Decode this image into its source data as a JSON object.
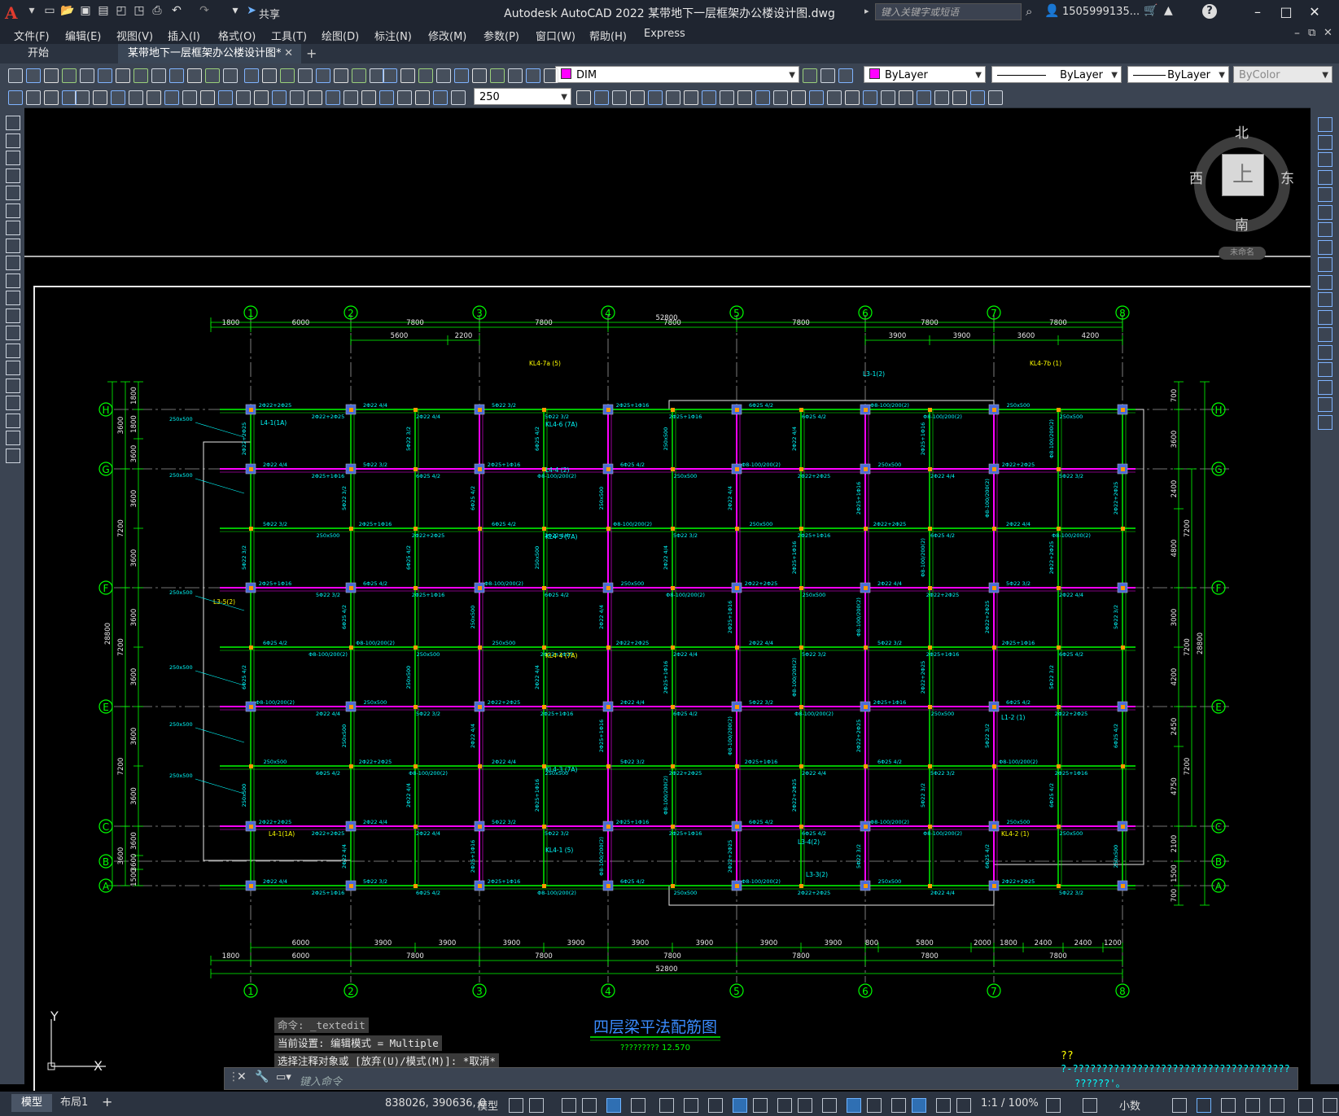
{
  "app": {
    "title": "Autodesk AutoCAD 2022    某带地下一层框架办公楼设计图.dwg",
    "share_label": "共享",
    "search_placeholder": "键入关键字或短语",
    "user": "1505999135...",
    "accent": "#e23b2e"
  },
  "menu": [
    "文件(F)",
    "编辑(E)",
    "视图(V)",
    "插入(I)",
    "格式(O)",
    "工具(T)",
    "绘图(D)",
    "标注(N)",
    "修改(M)",
    "参数(P)",
    "窗口(W)",
    "帮助(H)",
    "Express"
  ],
  "tabs": [
    {
      "label": "开始",
      "active": false
    },
    {
      "label": "某带地下一层框架办公楼设计图*",
      "active": true
    }
  ],
  "toolbar": {
    "layer": "DIM",
    "color": "ByLayer",
    "linetype": "ByLayer",
    "lineweight": "ByLayer",
    "plotstyle": "ByColor",
    "dimscale": "250"
  },
  "viewcube": {
    "north": "北",
    "south": "南",
    "east": "东",
    "west": "西",
    "face": "上",
    "wcs": "未命名"
  },
  "drawing": {
    "title": "四层梁平法配筋图",
    "subtitle": "?????????  12.570",
    "col_axes": [
      "1",
      "2",
      "3",
      "4",
      "5",
      "6",
      "7",
      "8"
    ],
    "row_axes": [
      "H",
      "G",
      "F",
      "E",
      "C",
      "B",
      "A"
    ],
    "top_dims_1": [
      "1800",
      "6000",
      "7800",
      "7800",
      "7800",
      "7800",
      "7800",
      "7800"
    ],
    "top_total": "52800",
    "top_dims_2": [
      "5600",
      "2200",
      "3900",
      "3900",
      "3600",
      "4200"
    ],
    "bottom_dims_1": [
      "6000",
      "3900",
      "3900",
      "3900",
      "3900",
      "3900",
      "3900",
      "3900",
      "3900",
      "800",
      "5800",
      "2000",
      "1800",
      "2400",
      "2400",
      "1200"
    ],
    "bottom_dims_2": [
      "1800",
      "6000",
      "7800",
      "7800",
      "7800",
      "7800",
      "7800",
      "7800"
    ],
    "bottom_total": "52800",
    "left_dims": [
      "1800",
      "1800",
      "3600",
      "3600",
      "3600",
      "3600",
      "3600",
      "3600",
      "3600",
      "3600",
      "3600",
      "1500",
      "1800"
    ],
    "left_dims_b": [
      "3600",
      "7200",
      "7200",
      "7200",
      "3600"
    ],
    "left_total": "28800",
    "right_dims": [
      "700",
      "3600",
      "2400",
      "4800",
      "3000",
      "4200",
      "2450",
      "4750",
      "2100",
      "1500",
      "700"
    ],
    "right_dims_b": [
      "7200",
      "7200",
      "7200"
    ],
    "right_total": "28800",
    "beam_labels": [
      "KL4-7a (5)",
      "KL4-6 (7A)",
      "KL4-5 (7A)",
      "KL4-4 (7A)",
      "KL4-3 (7A)",
      "KL4-1 (5)",
      "KL4-7b (1)",
      "L4-1(1A)",
      "L4-4 (2)",
      "L3-5(2)",
      "L3-1(2)",
      "L1-2 (1)",
      "KL4-2 (1)",
      "L3-4(2)",
      "L3-3(2)",
      "L4-1(1A)"
    ],
    "sample_notes": [
      "2Φ22+2Φ25",
      "2Φ22 4/4",
      "5Φ22 3/2",
      "2Φ25+1Φ16",
      "6Φ25 4/2",
      "Φ8-100/200(2)",
      "250x500"
    ]
  },
  "command": {
    "history": [
      "命令: _textedit",
      "当前设置: 编辑模式 = Multiple",
      "选择注释对象或 [放弃(U)/模式(M)]: *取消*"
    ],
    "placeholder": "键入命令",
    "garbled_1": "??",
    "garbled_2": "?-?????????????????????????????????????",
    "garbled_3": "??????'。"
  },
  "status": {
    "layouts": [
      "模型",
      "布局1"
    ],
    "coords": "838026, 390636, 0",
    "space": "模型",
    "scale": "1:1 / 100%",
    "units": "小数"
  },
  "colors": {
    "axis_green": "#00ff00",
    "beam_magenta": "#ff00ff",
    "annot_cyan": "#00ffff",
    "wall_white": "#e8e8e8",
    "label_yellow": "#ffff00",
    "column_blue": "#4a6bd8"
  }
}
